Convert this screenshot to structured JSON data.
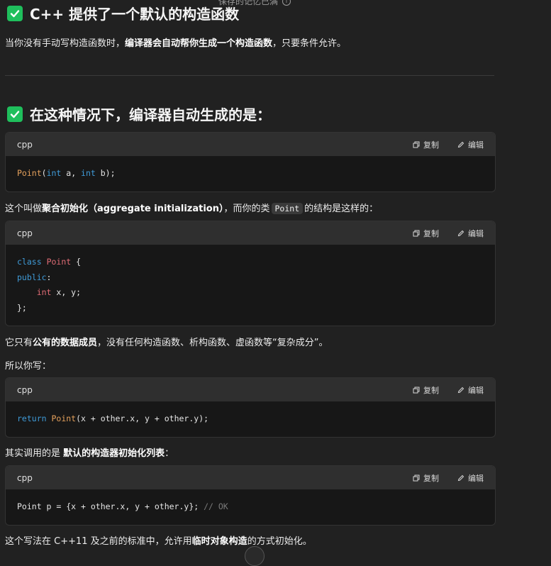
{
  "top_notice": "保存的记忆已满",
  "sections": {
    "s1": {
      "title": "C++ 提供了一个默认的构造函数",
      "body_prefix": "当你没有手动写构造函数时，",
      "body_bold": "编译器会自动帮你生成一个构造函数",
      "body_suffix": "，只要条件允许。"
    },
    "s2": {
      "title": "在这种情况下，编译器自动生成的是："
    }
  },
  "code_labels": {
    "lang": "cpp",
    "copy": "复制",
    "edit": "编辑"
  },
  "code1": {
    "fn": "Point",
    "open": "(",
    "kw1": "int",
    "a": " a, ",
    "kw2": "int",
    "b": " b);"
  },
  "p_aggregate": {
    "prefix": "这个叫做",
    "bold": "聚合初始化（aggregate initialization）",
    "mid": "，而你的类",
    "code": "Point",
    "suffix": "的结构是这样的："
  },
  "code2": {
    "kw_class": "class",
    "type_point": "Point",
    "brace_open": " {",
    "kw_public": "public",
    "colon": ":",
    "indent": "    ",
    "kw_int": "int",
    "members": " x, y;",
    "brace_close": "};"
  },
  "p_public": {
    "prefix": "它只有",
    "bold": "公有的数据成员",
    "suffix": "，没有任何构造函数、析构函数、虚函数等“复杂成分”。"
  },
  "p_sowrite": "所以你写：",
  "code3": {
    "kw_return": "return",
    "sp": " ",
    "fn": "Point",
    "rest": "(x + other.x, y + other.y);"
  },
  "p_actually": {
    "prefix": "其实调用的是 ",
    "bold": "默认的构造器初始化列表",
    "suffix": "："
  },
  "code4": {
    "stmt": "Point p = {x + other.x, y + other.y}; ",
    "comment": "// OK"
  },
  "p_last": {
    "prefix": "这个写法在 C++11 及之前的标准中，允许用",
    "bold": "临时对象构造",
    "suffix": "的方式初始化。"
  },
  "colors": {
    "background": "#212121",
    "code_bg": "#171717",
    "code_header": "#2f2f2f",
    "check_green": "#1fbf5c",
    "keyword": "#3f9bd8",
    "type": "#e06c75",
    "function": "#e5a15c",
    "comment": "#7a7a7a"
  },
  "icons": [
    "check-icon",
    "info-icon",
    "copy-icon",
    "edit-icon"
  ]
}
